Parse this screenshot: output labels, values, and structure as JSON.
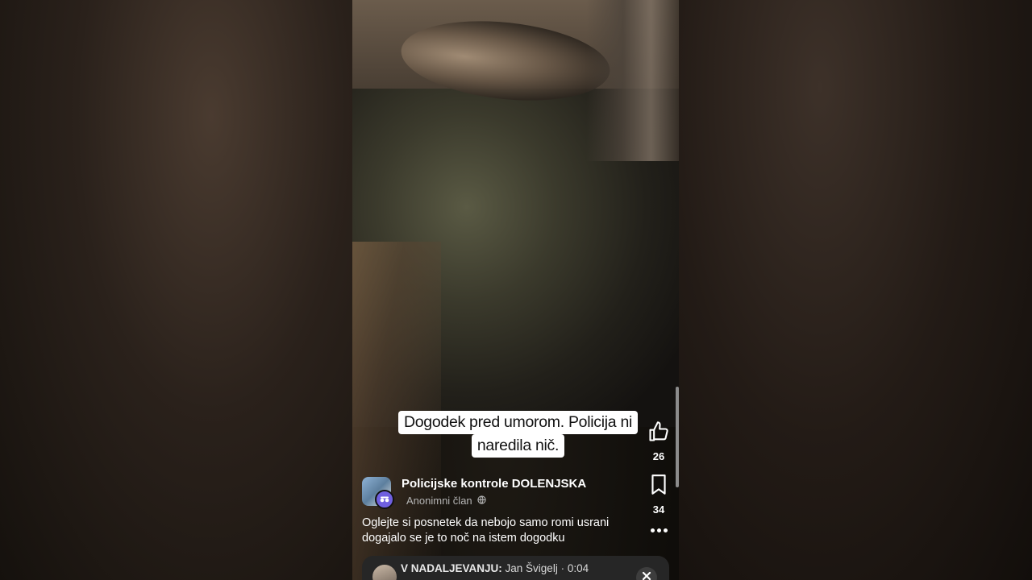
{
  "caption": {
    "line1": "Dogodek pred umorom. Policija ni",
    "line2": "naredila nič."
  },
  "actions": {
    "like_count": "26",
    "save_count": "34"
  },
  "post": {
    "group_name": "Policijske kontrole DOLENJSKA",
    "member_label": "Anonimni član",
    "text": "Oglejte si posnetek da nebojo samo romi usrani dogajalo se je to noč na istem dogodku"
  },
  "up_next": {
    "prefix": "V NADALJEVANJU:",
    "author": "Jan Švigelj",
    "separator": "·",
    "duration": "0:04"
  },
  "icons": {
    "like": "thumbs-up-icon",
    "save": "bookmark-icon",
    "more": "more-dots-icon",
    "anon": "anonymous-icon",
    "globe": "globe-icon",
    "close": "close-icon"
  },
  "colors": {
    "anon_badge": "#6f5fe0",
    "caption_bg": "#ffffff",
    "next_bar_bg": "#262626"
  }
}
